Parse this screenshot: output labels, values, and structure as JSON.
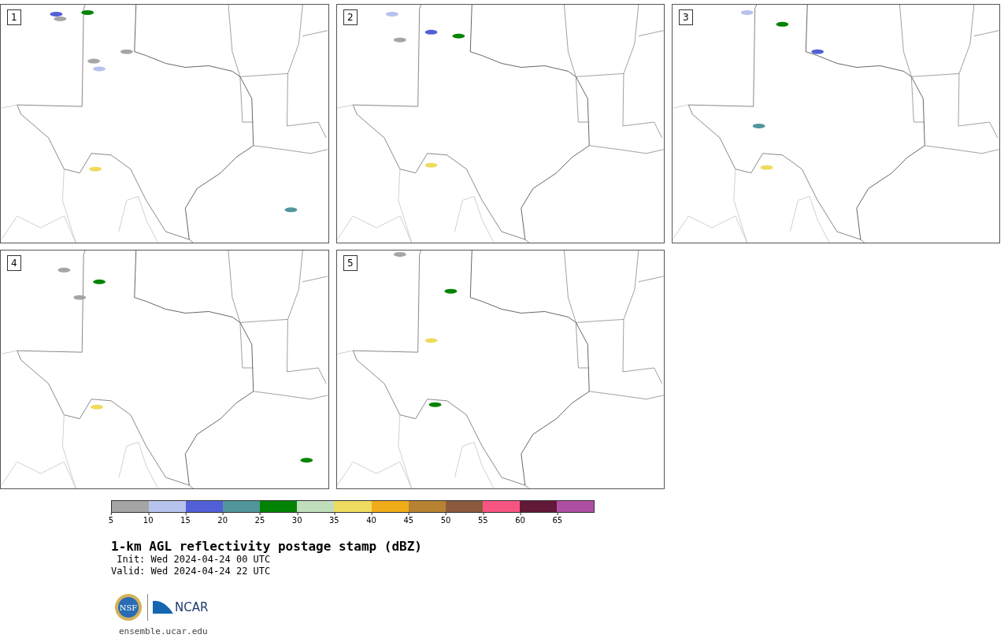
{
  "panels": [
    {
      "label": "1"
    },
    {
      "label": "2"
    },
    {
      "label": "3"
    },
    {
      "label": "4"
    },
    {
      "label": "5"
    }
  ],
  "colorbar": {
    "segments": [
      {
        "color": "#a5a5a5"
      },
      {
        "color": "#b7c3ec"
      },
      {
        "color": "#5260d7"
      },
      {
        "color": "#51969b"
      },
      {
        "color": "#038303"
      },
      {
        "color": "#c0ddbc"
      },
      {
        "color": "#eedb5f"
      },
      {
        "color": "#efab18"
      },
      {
        "color": "#b78232"
      },
      {
        "color": "#8b5a3e"
      },
      {
        "color": "#f65581"
      },
      {
        "color": "#621937"
      },
      {
        "color": "#b04ea4"
      }
    ],
    "ticks": [
      "5",
      "10",
      "15",
      "20",
      "25",
      "30",
      "35",
      "40",
      "45",
      "50",
      "55",
      "60",
      "65"
    ]
  },
  "title": "1-km AGL reflectivity postage stamp (dBZ)",
  "init": " Init: Wed 2024-04-24 00 UTC",
  "valid": "Valid: Wed 2024-04-24 22 UTC",
  "logos": {
    "nsf": "NSF",
    "ncar": "NCAR"
  },
  "url": "ensemble.ucar.edu"
}
